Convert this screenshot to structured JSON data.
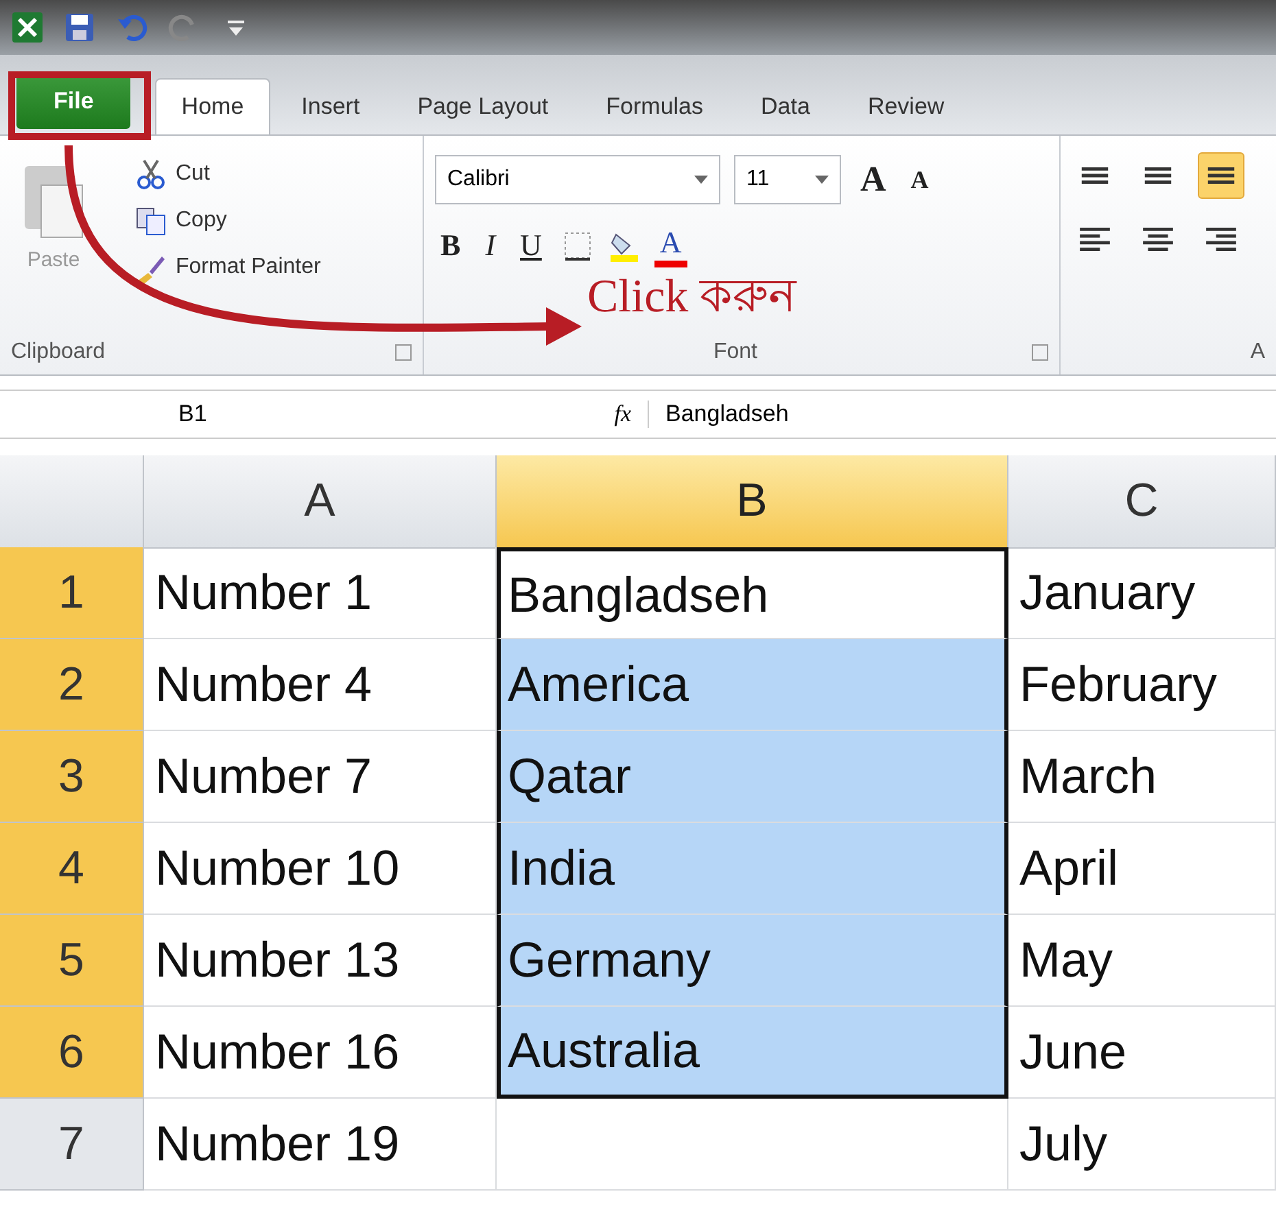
{
  "tabs": [
    {
      "label": "File",
      "kind": "file",
      "selected": false
    },
    {
      "label": "Home",
      "kind": "tab",
      "selected": true
    },
    {
      "label": "Insert",
      "kind": "tab",
      "selected": false
    },
    {
      "label": "Page Layout",
      "kind": "tab",
      "selected": false
    },
    {
      "label": "Formulas",
      "kind": "tab",
      "selected": false
    },
    {
      "label": "Data",
      "kind": "tab",
      "selected": false
    },
    {
      "label": "Review",
      "kind": "tab",
      "selected": false
    }
  ],
  "clipboard": {
    "paste": "Paste",
    "cut": "Cut",
    "copy": "Copy",
    "format_painter": "Format Painter",
    "label": "Clipboard"
  },
  "font": {
    "name": "Calibri",
    "size": "11",
    "grow": "A",
    "shrink": "A",
    "bold": "B",
    "italic": "I",
    "underline": "U",
    "color_button": "A",
    "label": "Font"
  },
  "alignment": {
    "buttons": [
      {
        "kind": "top",
        "selected": false
      },
      {
        "kind": "middle",
        "selected": false
      },
      {
        "kind": "bottom",
        "selected": true
      },
      {
        "kind": "left",
        "selected": false
      },
      {
        "kind": "center",
        "selected": false
      },
      {
        "kind": "right",
        "selected": false
      }
    ],
    "label": "A"
  },
  "annotation": {
    "text": "Click করুন"
  },
  "formula_bar": {
    "name_box": "B1",
    "fx": "fx",
    "value": "Bangladseh"
  },
  "sheet": {
    "columns": [
      {
        "label": "A",
        "selected": false
      },
      {
        "label": "B",
        "selected": true
      },
      {
        "label": "C",
        "selected": false
      }
    ],
    "rows": [
      {
        "number": "1",
        "selected": true,
        "active": true,
        "cells": [
          "Number 1",
          "Bangladseh",
          "January"
        ]
      },
      {
        "number": "2",
        "selected": true,
        "active": false,
        "cells": [
          "Number 4",
          "America",
          "February"
        ]
      },
      {
        "number": "3",
        "selected": true,
        "active": false,
        "cells": [
          "Number 7",
          "Qatar",
          "March"
        ]
      },
      {
        "number": "4",
        "selected": true,
        "active": false,
        "cells": [
          "Number 10",
          "India",
          "April"
        ]
      },
      {
        "number": "5",
        "selected": true,
        "active": false,
        "cells": [
          "Number 13",
          "Germany",
          "May"
        ]
      },
      {
        "number": "6",
        "selected": true,
        "active": false,
        "cells": [
          "Number 16",
          "Australia",
          "June"
        ]
      },
      {
        "number": "7",
        "selected": false,
        "active": false,
        "cells": [
          "Number 19",
          "",
          "July"
        ]
      }
    ]
  }
}
